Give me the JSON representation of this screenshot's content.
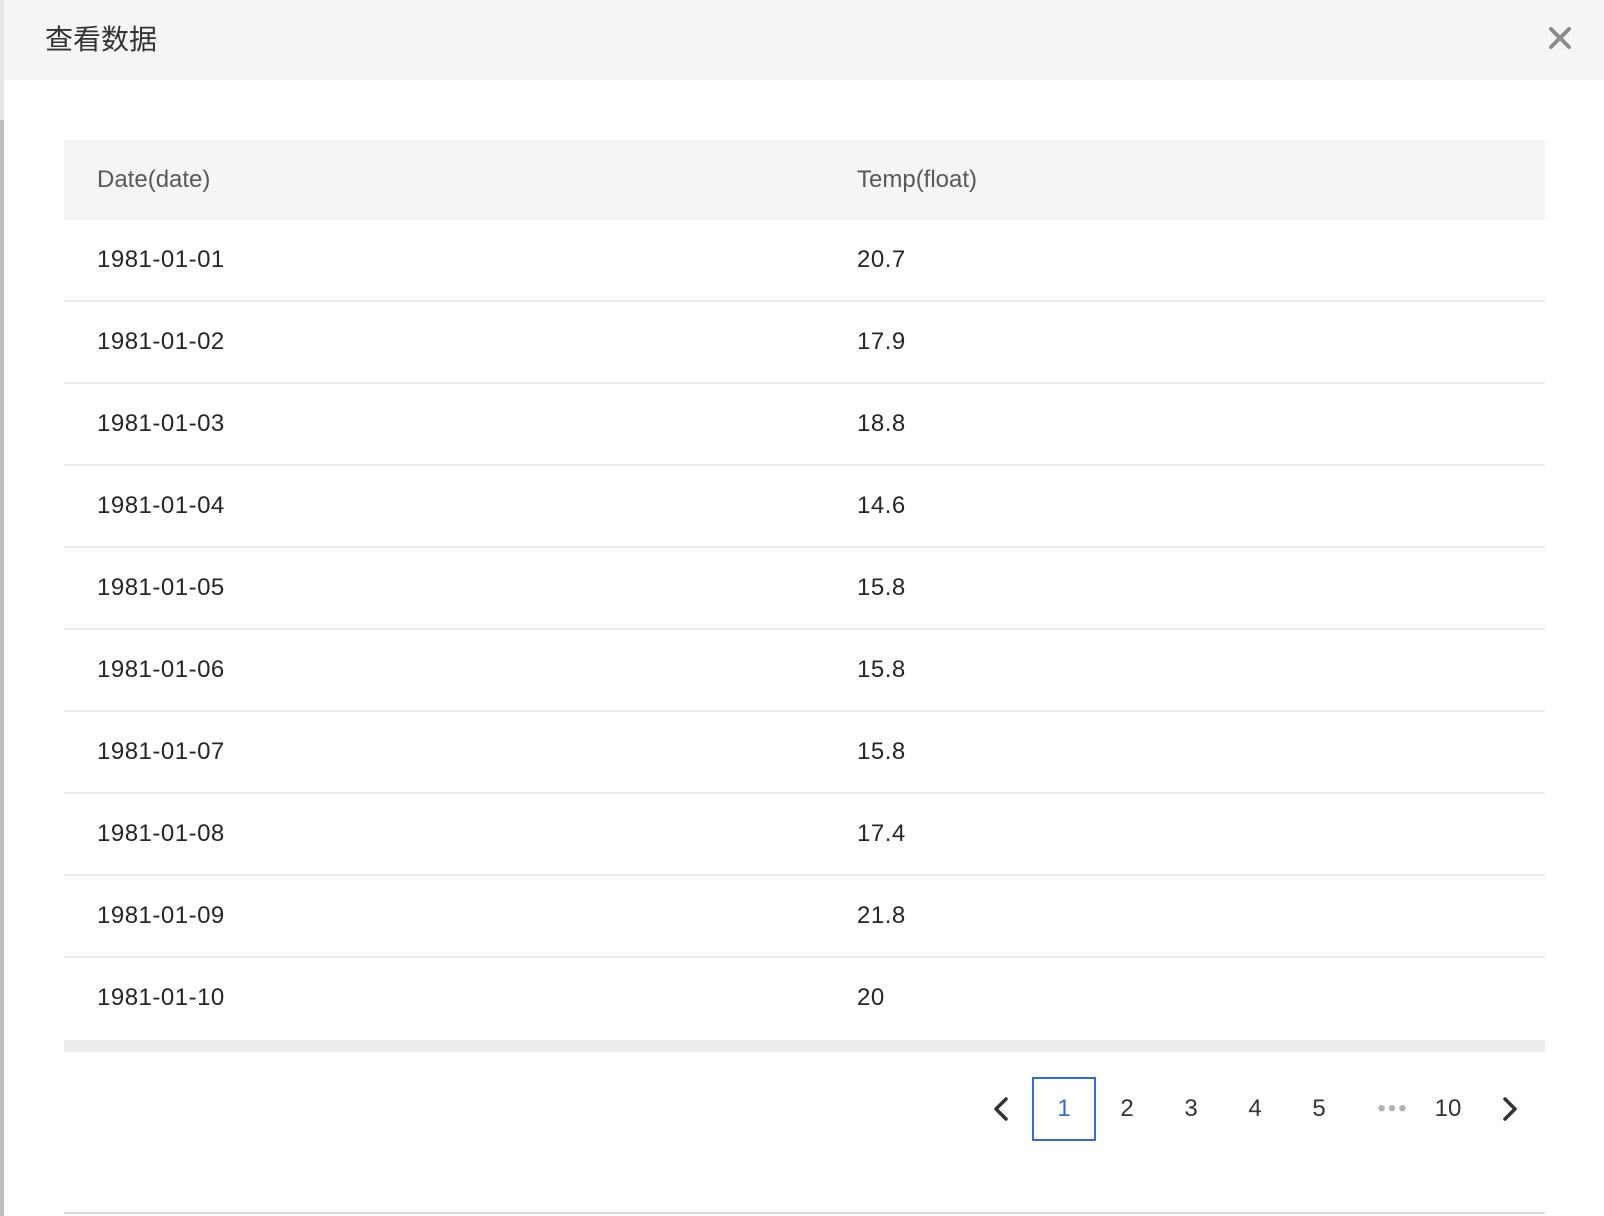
{
  "modal": {
    "title": "查看数据"
  },
  "table": {
    "columns": [
      "Date(date)",
      "Temp(float)"
    ],
    "rows": [
      [
        "1981-01-01",
        "20.7"
      ],
      [
        "1981-01-02",
        "17.9"
      ],
      [
        "1981-01-03",
        "18.8"
      ],
      [
        "1981-01-04",
        "14.6"
      ],
      [
        "1981-01-05",
        "15.8"
      ],
      [
        "1981-01-06",
        "15.8"
      ],
      [
        "1981-01-07",
        "15.8"
      ],
      [
        "1981-01-08",
        "17.4"
      ],
      [
        "1981-01-09",
        "21.8"
      ],
      [
        "1981-01-10",
        "20"
      ]
    ]
  },
  "pagination": {
    "pages": [
      "1",
      "2",
      "3",
      "4",
      "5"
    ],
    "ellipsis": "•••",
    "last_page": "10",
    "current_page": "1"
  },
  "colors": {
    "accent": "#2f6fd1",
    "header_bg": "#f5f5f5"
  }
}
